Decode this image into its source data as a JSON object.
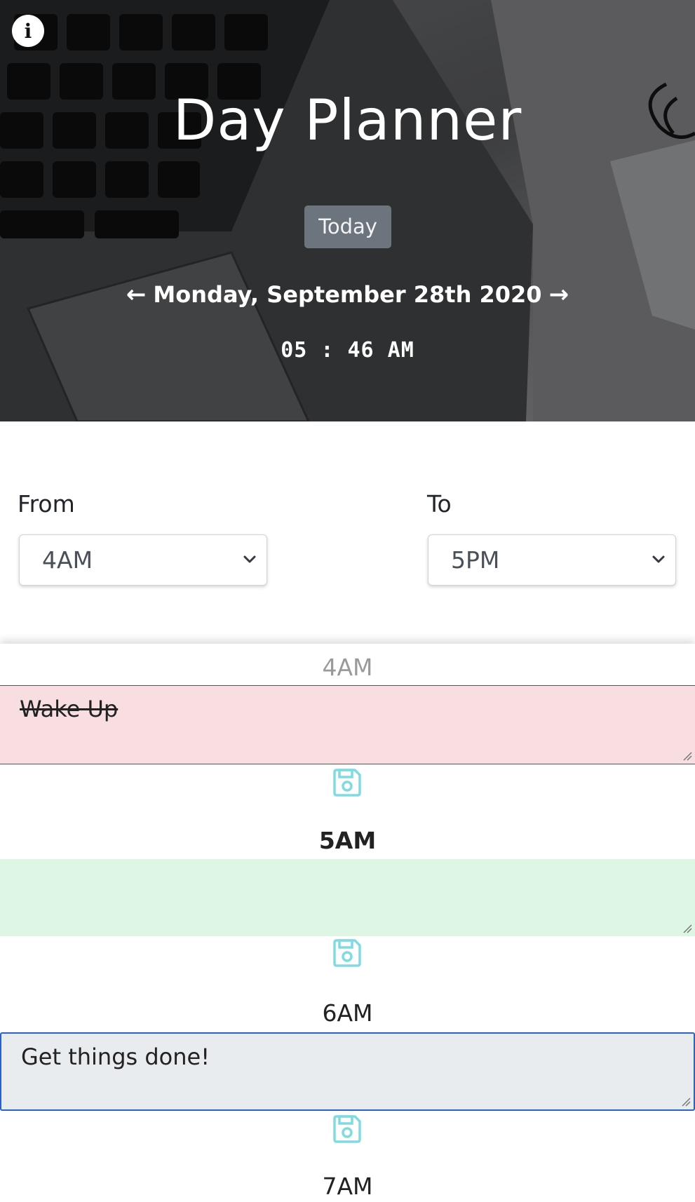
{
  "header": {
    "title": "Day Planner",
    "today_label": "Today",
    "date": "Monday, September 28th 2020",
    "clock": "05 : 46 AM",
    "info_icon": "info-circle-icon",
    "prev_icon": "arrow-left-icon",
    "next_icon": "arrow-right-icon"
  },
  "range": {
    "from_label": "From",
    "from_value": "4AM",
    "to_label": "To",
    "to_value": "5PM"
  },
  "colors": {
    "past": "#f8dde1",
    "present": "#def6e4",
    "future": "#e9ecef",
    "save_icon": "#7fdbe0",
    "today_button": "#6c757d"
  },
  "schedule": [
    {
      "hour": "4AM",
      "state": "past",
      "note": "Wake Up"
    },
    {
      "hour": "5AM",
      "state": "present",
      "note": ""
    },
    {
      "hour": "6AM",
      "state": "future",
      "note": "Get things done!"
    },
    {
      "hour": "7AM",
      "state": "future",
      "note": ""
    }
  ]
}
